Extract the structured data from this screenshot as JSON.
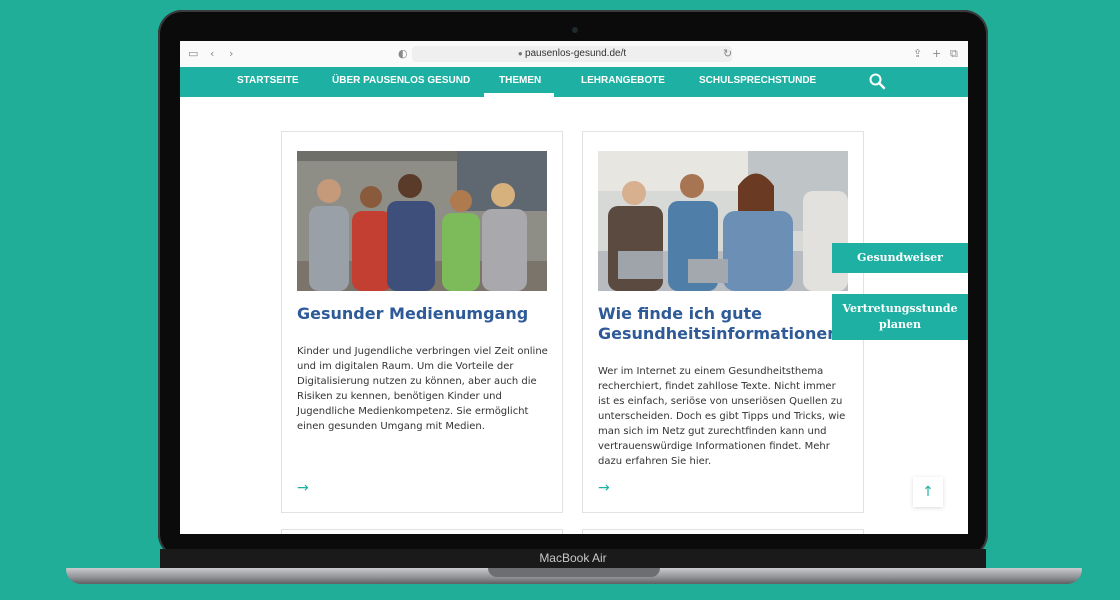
{
  "device": {
    "label": "MacBook Air"
  },
  "browser": {
    "url": "pausenlos-gesund.de/t"
  },
  "nav": {
    "items": [
      "STARTSEITE",
      "ÜBER PAUSENLOS GESUND",
      "THEMEN",
      "LEHRANGEBOTE",
      "SCHULSPRECHSTUNDE"
    ],
    "active": "THEMEN"
  },
  "cards": [
    {
      "title": "Gesunder Medienumgang",
      "text": "Kinder und Jugendliche verbringen viel Zeit online und im digitalen Raum. Um die Vorteile der Digitalisierung nutzen zu können, aber auch die Risiken zu kennen, benötigen Kinder und Jugendliche Medienkompetenz. Sie ermöglicht einen gesunden Umgang mit Medien.",
      "arrow": "→"
    },
    {
      "title": "Wie finde ich gute Gesundheitsinformationen?",
      "text": "Wer im Internet zu einem Gesundheitsthema recherchiert, findet zahllose Texte. Nicht immer ist es einfach, seriöse von unseriösen Quellen zu unterscheiden. Doch es gibt Tipps und Tricks, wie man sich im Netz gut zurechtfinden kann und vertrauenswürdige Informationen findet. Mehr dazu erfahren Sie hier.",
      "arrow": "→"
    }
  ],
  "side_buttons": [
    "Gesundweiser",
    "Vertretungsstunde planen"
  ],
  "back_to_top": "↑",
  "colors": {
    "background": "#20ae98",
    "nav": "#1eb1a3",
    "title": "#2e5a97"
  },
  "icons": [
    "sidebar-icon",
    "back-icon",
    "forward-icon",
    "shield-icon",
    "lock-icon",
    "reload-icon",
    "share-icon",
    "new-tab-icon",
    "tabs-icon",
    "search-icon"
  ]
}
